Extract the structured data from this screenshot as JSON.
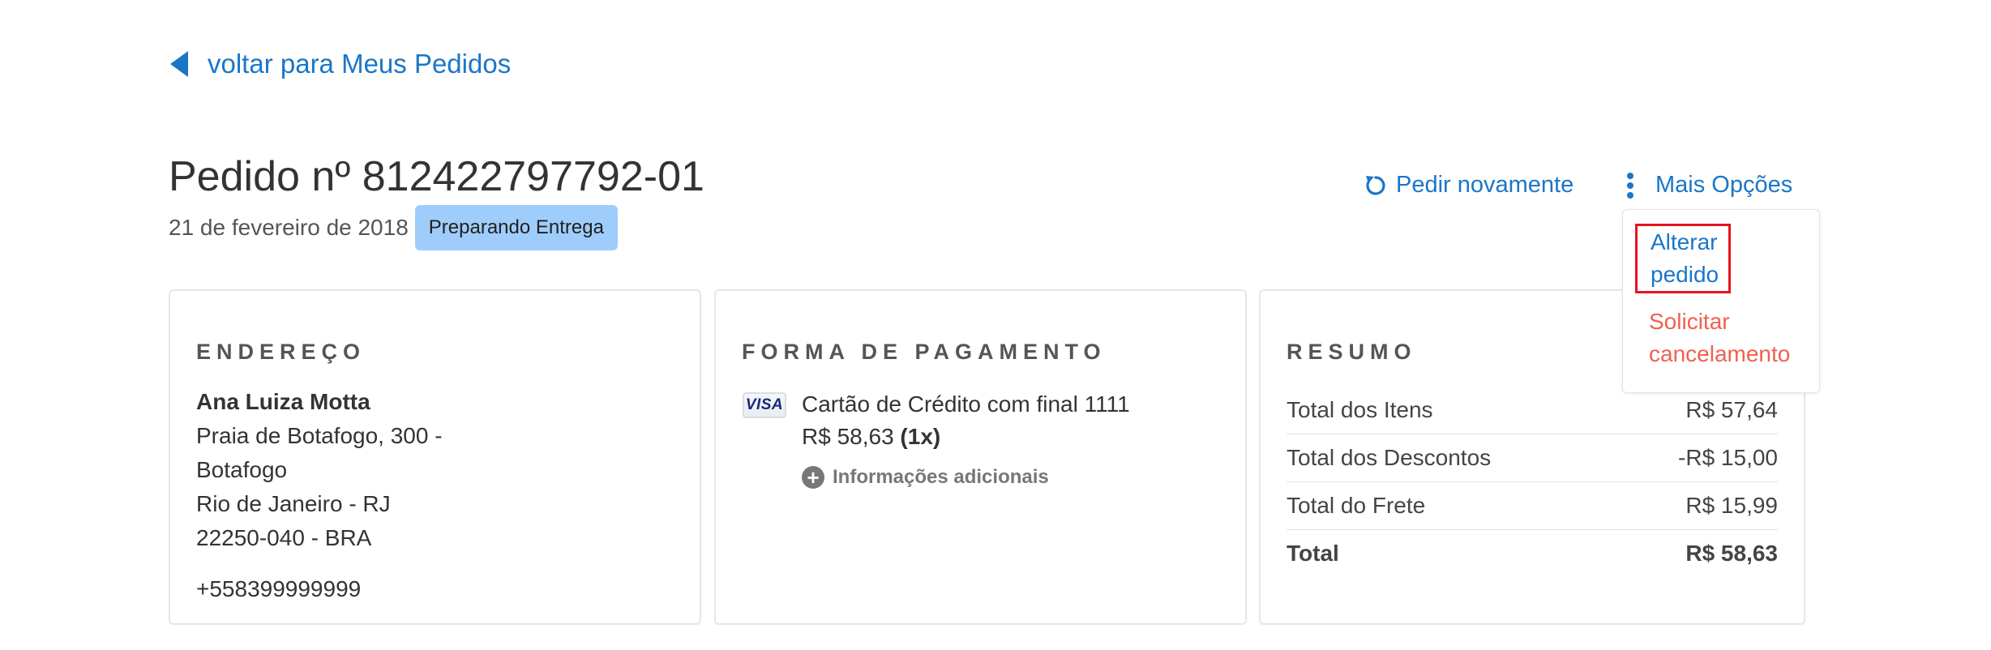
{
  "back": {
    "label": "voltar para Meus Pedidos"
  },
  "order": {
    "title": "Pedido nº 812422797792-01",
    "date": "21 de fevereiro de 2018",
    "status": "Preparando Entrega"
  },
  "actions": {
    "reorder_label": "Pedir novamente",
    "more_label": "Mais Opções",
    "menu": {
      "edit_line1": "Alterar",
      "edit_line2": "pedido",
      "cancel_line1": "Solicitar",
      "cancel_line2": "cancelamento"
    }
  },
  "address": {
    "title": "ENDEREÇO",
    "name": "Ana Luiza Motta",
    "line1": "Praia de Botafogo, 300 -",
    "line2": "Botafogo",
    "line3": "Rio de Janeiro - RJ",
    "line4": "22250-040 - BRA",
    "phone": "+558399999999"
  },
  "payment": {
    "title": "FORMA DE PAGAMENTO",
    "card_brand": "VISA",
    "description": "Cartão de Crédito com final 1111",
    "amount": "R$ 58,63",
    "installments": "(1x)",
    "more_info": "Informações adicionais"
  },
  "summary": {
    "title": "RESUMO",
    "rows": [
      {
        "label": "Total dos Itens",
        "value": "R$ 57,64"
      },
      {
        "label": "Total dos Descontos",
        "value": "-R$ 15,00"
      },
      {
        "label": "Total do Frete",
        "value": "R$ 15,99"
      },
      {
        "label": "Total",
        "value": "R$ 58,63"
      }
    ]
  },
  "colors": {
    "link": "#1b76c9",
    "badge": "#9fcdfb",
    "cancel": "#f0604f",
    "highlight": "#e8121f"
  }
}
